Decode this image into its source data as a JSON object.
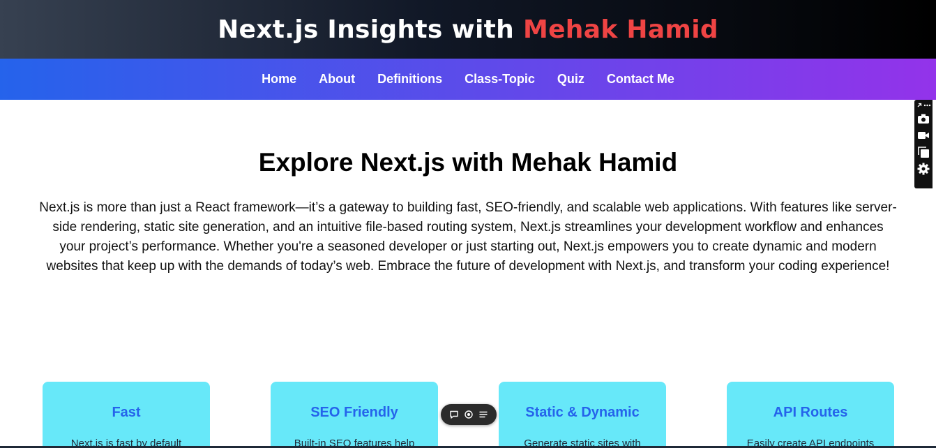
{
  "header": {
    "title_main": "Next.js Insights with",
    "title_accent": "Mehak Hamid",
    "colors": {
      "accent": "#ef4444",
      "background_start": "#374151",
      "background_end": "#000000"
    }
  },
  "nav": {
    "items": [
      {
        "label": "Home"
      },
      {
        "label": "About"
      },
      {
        "label": "Definitions"
      },
      {
        "label": "Class-Topic"
      },
      {
        "label": "Quiz"
      },
      {
        "label": "Contact Me"
      }
    ],
    "colors": {
      "gradient_start": "#2563eb",
      "gradient_end": "#9333ea"
    }
  },
  "hero": {
    "heading": "Explore Next.js with Mehak Hamid",
    "text": "Next.js is more than just a React framework—it’s a gateway to building fast, SEO-friendly, and scalable web applications. With features like server-side rendering, static site generation, and an intuitive file-based routing system, Next.js streamlines your development workflow and enhances your project’s performance. Whether you're a seasoned developer or just starting out, Next.js empowers you to create dynamic and modern websites that keep up with the demands of today’s web. Embrace the future of development with Next.js, and transform your coding experience!"
  },
  "features": {
    "cards": [
      {
        "title": "Fast",
        "description": "Next.js is fast by default"
      },
      {
        "title": "SEO Friendly",
        "description": "Built-in SEO features help"
      },
      {
        "title": "Static & Dynamic",
        "description": "Generate static sites with"
      },
      {
        "title": "API Routes",
        "description": "Easily create API endpoints"
      }
    ],
    "colors": {
      "card_bg": "#67e8f9",
      "card_title": "#2563eb"
    }
  },
  "floating_toolbar": {
    "icons": [
      "comment-icon",
      "record-icon",
      "menu-icon"
    ]
  },
  "side_panel": {
    "icons": [
      "link-icon",
      "more-icon",
      "camera-icon",
      "video-icon",
      "copy-icon",
      "settings-icon"
    ]
  }
}
